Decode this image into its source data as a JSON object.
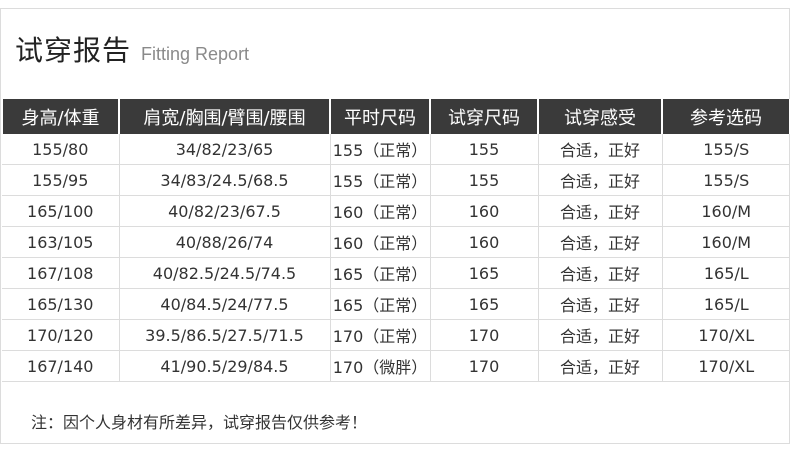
{
  "title": {
    "cn": "试穿报告",
    "en": "Fitting Report"
  },
  "table": {
    "headers": [
      "身高/体重",
      "肩宽/胸围/臂围/腰围",
      "平时尺码",
      "试穿尺码",
      "试穿感受",
      "参考选码"
    ],
    "rows": [
      [
        "155/80",
        "34/82/23/65",
        "155（正常）",
        "155",
        "合适，正好",
        "155/S"
      ],
      [
        "155/95",
        "34/83/24.5/68.5",
        "155（正常）",
        "155",
        "合适，正好",
        "155/S"
      ],
      [
        "165/100",
        "40/82/23/67.5",
        "160（正常）",
        "160",
        "合适，正好",
        "160/M"
      ],
      [
        "163/105",
        "40/88/26/74",
        "160（正常）",
        "160",
        "合适，正好",
        "160/M"
      ],
      [
        "167/108",
        "40/82.5/24.5/74.5",
        "165（正常）",
        "165",
        "合适，正好",
        "165/L"
      ],
      [
        "165/130",
        "40/84.5/24/77.5",
        "165（正常）",
        "165",
        "合适，正好",
        "165/L"
      ],
      [
        "170/120",
        "39.5/86.5/27.5/71.5",
        "170（正常）",
        "170",
        "合适，正好",
        "170/XL"
      ],
      [
        "167/140",
        "41/90.5/29/84.5",
        "170（微胖）",
        "170",
        "合适，正好",
        "170/XL"
      ]
    ]
  },
  "note": "注：因个人身材有所差异，试穿报告仅供参考！",
  "colors": {
    "header_bg": "#3a3a3a",
    "header_text": "#ffffff",
    "border": "#dcdcdc"
  }
}
